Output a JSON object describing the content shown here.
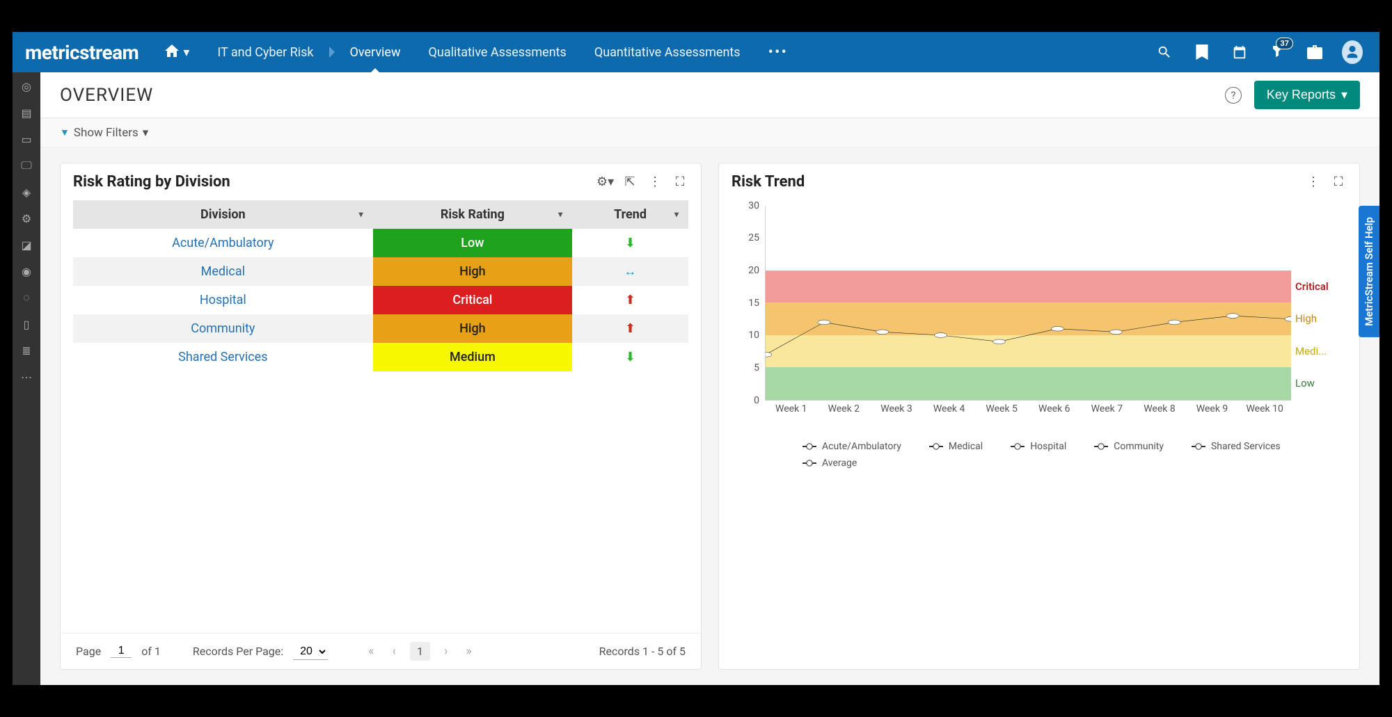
{
  "brand": "metricstream",
  "nav": {
    "home_label": "IT and Cyber Risk",
    "items": [
      "Overview",
      "Qualitative Assessments",
      "Quantitative Assessments"
    ],
    "active_index": 0,
    "notification_count": "37"
  },
  "page": {
    "title": "OVERVIEW",
    "key_reports_label": "Key Reports",
    "show_filters_label": "Show Filters"
  },
  "left_panel": {
    "title": "Risk Rating by Division",
    "columns": [
      "Division",
      "Risk Rating",
      "Trend"
    ],
    "rows": [
      {
        "division": "Acute/Ambulatory",
        "rating": "Low",
        "rating_class": "rating-low",
        "trend": "down"
      },
      {
        "division": "Medical",
        "rating": "High",
        "rating_class": "rating-high",
        "trend": "flat"
      },
      {
        "division": "Hospital",
        "rating": "Critical",
        "rating_class": "rating-critical",
        "trend": "up"
      },
      {
        "division": "Community",
        "rating": "High",
        "rating_class": "rating-high",
        "trend": "up"
      },
      {
        "division": "Shared Services",
        "rating": "Medium",
        "rating_class": "rating-medium",
        "trend": "down"
      }
    ],
    "footer": {
      "page_label": "Page",
      "page_current": "1",
      "of_label": "of 1",
      "rpp_label": "Records Per Page:",
      "rpp_value": "20",
      "records_label": "Records 1 - 5 of 5"
    }
  },
  "right_panel": {
    "title": "Risk Trend",
    "band_labels": {
      "critical": "Critical",
      "high": "High",
      "medium": "Medi...",
      "low": "Low"
    },
    "legend": [
      "Acute/Ambulatory",
      "Medical",
      "Hospital",
      "Community",
      "Shared Services",
      "Average"
    ]
  },
  "self_help_label": "MetricStream Self Help",
  "chart_data": {
    "type": "line",
    "title": "Risk Trend",
    "xlabel": "",
    "ylabel": "",
    "ylim": [
      0,
      30
    ],
    "y_ticks": [
      0,
      5,
      10,
      15,
      20,
      25,
      30
    ],
    "categories": [
      "Week 1",
      "Week 2",
      "Week 3",
      "Week 4",
      "Week 5",
      "Week 6",
      "Week 7",
      "Week 8",
      "Week 9",
      "Week 10"
    ],
    "bands": [
      {
        "name": "Critical",
        "from": 15,
        "to": 20,
        "color": "#f29c9c"
      },
      {
        "name": "High",
        "from": 10,
        "to": 15,
        "color": "#f5c46f"
      },
      {
        "name": "Medium",
        "from": 5,
        "to": 10,
        "color": "#f9e89c"
      },
      {
        "name": "Low",
        "from": 0,
        "to": 5,
        "color": "#a7d9a7"
      }
    ],
    "series": [
      {
        "name": "Average",
        "values": [
          7,
          12,
          10.5,
          10,
          9,
          11,
          10.5,
          12,
          13,
          12.5
        ]
      }
    ],
    "legend_series": [
      "Acute/Ambulatory",
      "Medical",
      "Hospital",
      "Community",
      "Shared Services",
      "Average"
    ]
  }
}
